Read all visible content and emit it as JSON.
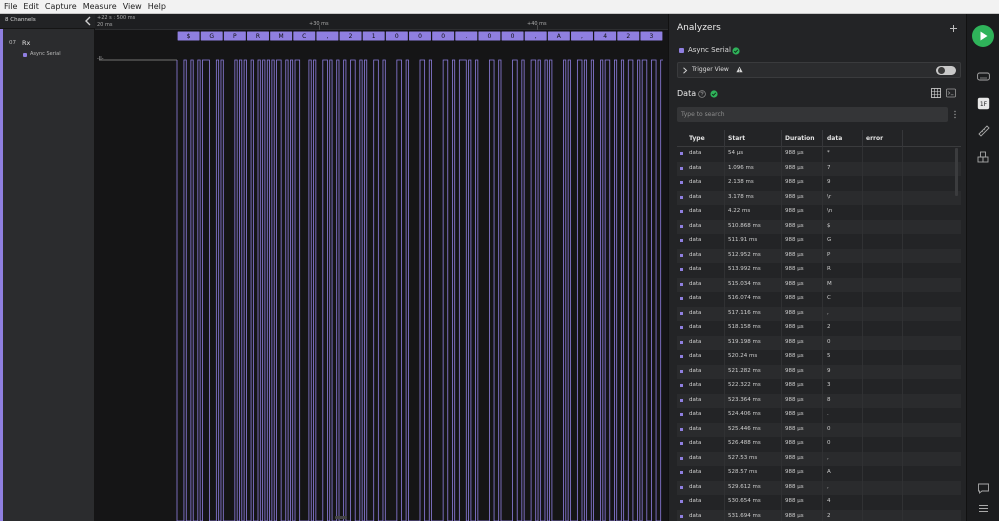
{
  "menu": [
    "File",
    "Edit",
    "Capture",
    "Measure",
    "View",
    "Help"
  ],
  "channels": {
    "header": "8 Channels",
    "channel_number": "07",
    "channel_name": "Rx",
    "analyzer_tag": "Async Serial"
  },
  "timeline": {
    "origin": "+22 s : 500 ms",
    "scale": "20 ms",
    "labels": [
      "+30 ms",
      "+40 ms"
    ],
    "empty_marker": "-II-"
  },
  "decoded_frames": [
    "$",
    "G",
    "P",
    "R",
    "M",
    "C",
    ",",
    "2",
    "1",
    "0",
    "0",
    "0",
    ".",
    "0",
    "0",
    ",",
    "A",
    ",",
    "4",
    "2",
    "3"
  ],
  "analyzers": {
    "title": "Analyzers",
    "name": "Async Serial",
    "trigger_view": "Trigger View",
    "data_title": "Data",
    "search_placeholder": "Type to search",
    "columns": [
      "Type",
      "Start",
      "Duration",
      "data",
      "error"
    ]
  },
  "rows": [
    {
      "type": "data",
      "start": "54 µs",
      "duration": "988 µs",
      "data": "*",
      "error": ""
    },
    {
      "type": "data",
      "start": "1.096 ms",
      "duration": "988 µs",
      "data": "7",
      "error": ""
    },
    {
      "type": "data",
      "start": "2.138 ms",
      "duration": "988 µs",
      "data": "9",
      "error": ""
    },
    {
      "type": "data",
      "start": "3.178 ms",
      "duration": "988 µs",
      "data": "\\r",
      "error": ""
    },
    {
      "type": "data",
      "start": "4.22 ms",
      "duration": "988 µs",
      "data": "\\n",
      "error": ""
    },
    {
      "type": "data",
      "start": "510.868 ms",
      "duration": "988 µs",
      "data": "$",
      "error": ""
    },
    {
      "type": "data",
      "start": "511.91 ms",
      "duration": "988 µs",
      "data": "G",
      "error": ""
    },
    {
      "type": "data",
      "start": "512.952 ms",
      "duration": "988 µs",
      "data": "P",
      "error": ""
    },
    {
      "type": "data",
      "start": "513.992 ms",
      "duration": "988 µs",
      "data": "R",
      "error": ""
    },
    {
      "type": "data",
      "start": "515.034 ms",
      "duration": "988 µs",
      "data": "M",
      "error": ""
    },
    {
      "type": "data",
      "start": "516.074 ms",
      "duration": "988 µs",
      "data": "C",
      "error": ""
    },
    {
      "type": "data",
      "start": "517.116 ms",
      "duration": "988 µs",
      "data": ",",
      "error": ""
    },
    {
      "type": "data",
      "start": "518.158 ms",
      "duration": "988 µs",
      "data": "2",
      "error": ""
    },
    {
      "type": "data",
      "start": "519.198 ms",
      "duration": "988 µs",
      "data": "0",
      "error": ""
    },
    {
      "type": "data",
      "start": "520.24 ms",
      "duration": "988 µs",
      "data": "5",
      "error": ""
    },
    {
      "type": "data",
      "start": "521.282 ms",
      "duration": "988 µs",
      "data": "9",
      "error": ""
    },
    {
      "type": "data",
      "start": "522.322 ms",
      "duration": "988 µs",
      "data": "3",
      "error": ""
    },
    {
      "type": "data",
      "start": "523.364 ms",
      "duration": "988 µs",
      "data": "8",
      "error": ""
    },
    {
      "type": "data",
      "start": "524.406 ms",
      "duration": "988 µs",
      "data": ".",
      "error": ""
    },
    {
      "type": "data",
      "start": "525.446 ms",
      "duration": "988 µs",
      "data": "0",
      "error": ""
    },
    {
      "type": "data",
      "start": "526.488 ms",
      "duration": "988 µs",
      "data": "0",
      "error": ""
    },
    {
      "type": "data",
      "start": "527.53 ms",
      "duration": "988 µs",
      "data": ",",
      "error": ""
    },
    {
      "type": "data",
      "start": "528.57 ms",
      "duration": "988 µs",
      "data": "A",
      "error": ""
    },
    {
      "type": "data",
      "start": "529.612 ms",
      "duration": "988 µs",
      "data": ",",
      "error": ""
    },
    {
      "type": "data",
      "start": "530.654 ms",
      "duration": "988 µs",
      "data": "4",
      "error": ""
    },
    {
      "type": "data",
      "start": "531.694 ms",
      "duration": "988 µs",
      "data": "2",
      "error": ""
    }
  ],
  "colors": {
    "accent": "#8f7fe0",
    "play": "#2fb35a",
    "check": "#2fb35a"
  }
}
